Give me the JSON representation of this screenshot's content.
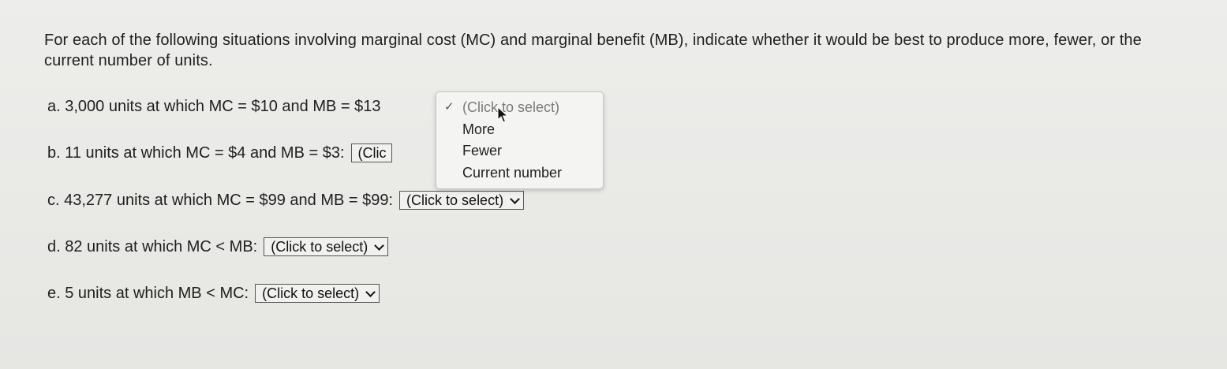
{
  "prompt": {
    "text": "For each of the following situations involving marginal cost (MC) and marginal benefit (MB), indicate whether it would be best to produce more, fewer, or the current number of units."
  },
  "questions": [
    {
      "label": "a. 3,000 units at which MC = $10 and MB = $13",
      "select_value": "(Click to select)"
    },
    {
      "label": "b. 11 units at which MC = $4 and MB = $3:",
      "select_value": "(Clic"
    },
    {
      "label": "c. 43,277 units at which MC = $99 and MB = $99:",
      "select_value": "(Click to select)"
    },
    {
      "label": "d. 82 units at which MC < MB:",
      "select_value": "(Click to select)"
    },
    {
      "label": "e. 5 units at which MB < MC:",
      "select_value": "(Click to select)"
    }
  ],
  "dropdown": {
    "checkmark": "✓",
    "options": [
      "(Click to select)",
      "More",
      "Fewer",
      "Current number"
    ]
  },
  "icons": {
    "select_arrow": "chevron-down-icon",
    "cursor": "mouse-pointer-icon"
  }
}
